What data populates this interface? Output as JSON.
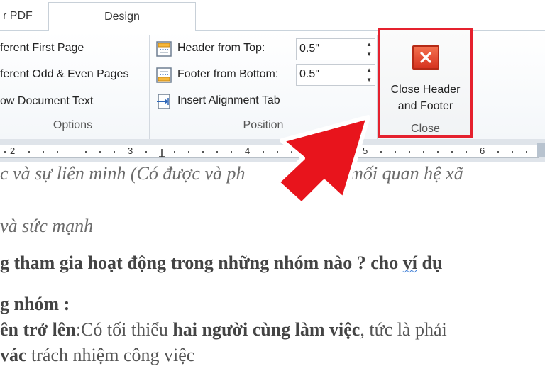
{
  "tabs": {
    "prev": "r PDF",
    "active": "Design"
  },
  "options": {
    "items": [
      "ferent First Page",
      "ferent Odd & Even Pages",
      "ow Document Text"
    ],
    "group_label": "Options"
  },
  "position": {
    "header_label": "Header from Top:",
    "header_value": "0.5\"",
    "footer_label": "Footer from Bottom:",
    "footer_value": "0.5\"",
    "align_label": "Insert Alignment Tab",
    "group_label": "Position"
  },
  "close": {
    "line1": "Close Header",
    "line2": "and Footer",
    "group_label": "Close"
  },
  "ruler": {
    "numbers": [
      "2",
      "3",
      "4",
      "5",
      "6"
    ]
  },
  "doc": {
    "l1": "c và sự liên minh (Có được và ph",
    "l1b": "ên các mối quan hệ xã",
    "l2": "và sức mạnh",
    "l3a": "g tham gia hoạt động trong những nhóm nào ? cho ",
    "l3b": "ví",
    "l3c": " dụ",
    "l4": "g nhóm :",
    "l5a": "ên trở lên",
    "l5b": ":Có tối thiểu ",
    "l5c": "hai người cùng làm việc",
    "l5d": ", tức là phải",
    "l6a": "vác",
    "l6b": " trách nhiệm công việc"
  },
  "colors": {
    "highlight_border": "#e5212e",
    "arrow": "#e8141c",
    "close_icon": "#d6331f"
  }
}
